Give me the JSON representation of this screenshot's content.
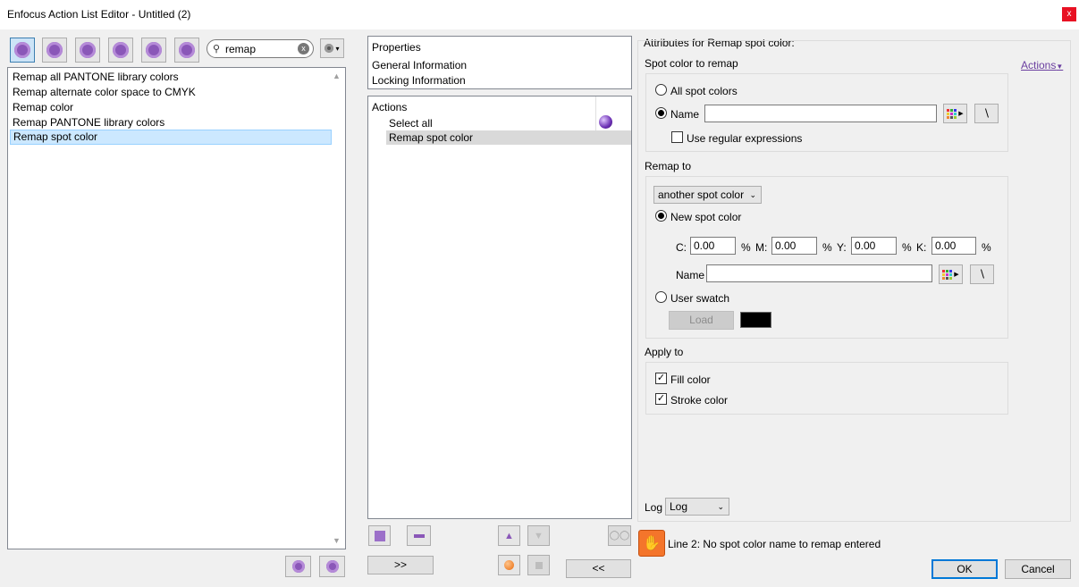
{
  "window": {
    "title": "Enfocus Action List Editor - Untitled (2)",
    "close_glyph": "x"
  },
  "toolbar": {
    "icons": [
      "gear-icon",
      "gear-search-icon",
      "gear-refresh-icon",
      "gear-check-icon",
      "gear-info-icon",
      "gear-wrench-icon"
    ],
    "search_value": "remap",
    "search_icon": "magnifier-icon",
    "clear_glyph": "x",
    "options_glyph": "▾"
  },
  "action_library": {
    "items": [
      "Remap all PANTONE library colors",
      "Remap alternate color space to CMYK",
      "Remap color",
      "Remap PANTONE library colors",
      "Remap spot color"
    ],
    "selected_index": 4
  },
  "properties": {
    "header": "Properties",
    "items": [
      "General Information",
      "Locking Information"
    ]
  },
  "actions": {
    "header": "Actions",
    "items": [
      "Select all",
      "Remap spot color"
    ],
    "selected_index": 1
  },
  "buttons": {
    "add": ">>",
    "remove": "<<",
    "ok": "OK",
    "cancel": "Cancel",
    "load": "Load"
  },
  "attributes": {
    "header": "Attributes for Remap spot color:",
    "actions_link": "Actions",
    "spot_section": {
      "title": "Spot color to remap",
      "all_spot_colors": "All spot colors",
      "name_label": "Name",
      "name_value": "",
      "use_regex": "Use regular expressions",
      "selected": "name"
    },
    "remap_section": {
      "title": "Remap to",
      "target_type": "another spot color",
      "new_spot_color": "New spot color",
      "cmyk": [
        {
          "label": "C:",
          "value": "0.00",
          "unit": "%"
        },
        {
          "label": "M:",
          "value": "0.00",
          "unit": "%"
        },
        {
          "label": "Y:",
          "value": "0.00",
          "unit": "%"
        },
        {
          "label": "K:",
          "value": "0.00",
          "unit": "%"
        }
      ],
      "name_label": "Name",
      "name_value": "",
      "user_swatch": "User swatch",
      "swatch_color": "#000000",
      "selected": "new_spot_color"
    },
    "apply_section": {
      "title": "Apply to",
      "fill_color": "Fill color",
      "stroke_color": "Stroke color",
      "fill_checked": true,
      "stroke_checked": true
    },
    "log_label": "Log",
    "log_value": "Log"
  },
  "status": {
    "message": "Line 2: No spot color name to remap entered",
    "icon": "warning-hand-icon"
  },
  "colors": {
    "accent": "#0078d7",
    "selection": "#cce8ff",
    "warning": "#f4752b",
    "link": "#6b3fa0"
  }
}
